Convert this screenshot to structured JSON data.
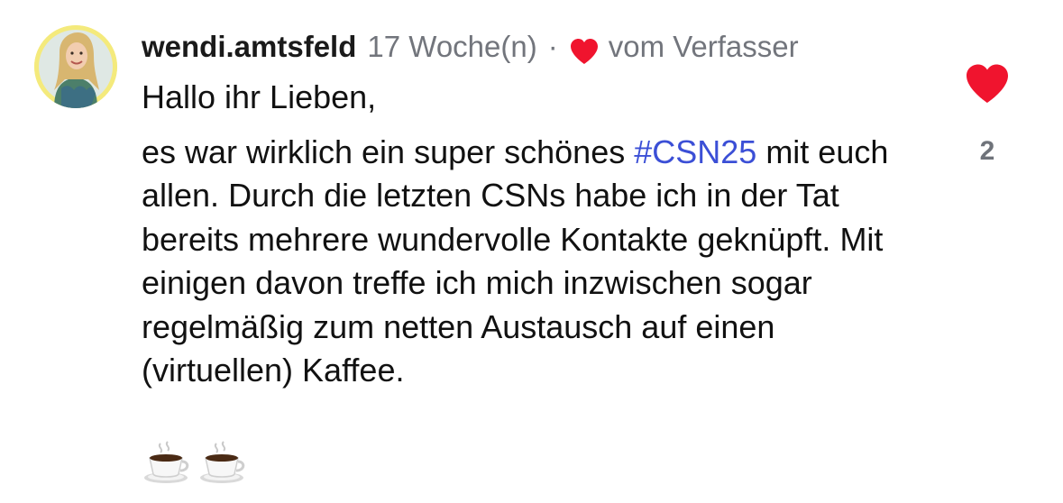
{
  "comment": {
    "username": "wendi.amtsfeld",
    "time": "17 Woche(n)",
    "separator": "·",
    "author_label": "vom Verfasser",
    "greeting": "Hallo ihr Lieben,",
    "text_before_hashtag": "es war wirklich ein super schönes ",
    "hashtag": "#CSN25",
    "text_after_hashtag": " mit euch allen. Durch die letzten CSNs habe ich in der Tat bereits mehrere wundervolle Kontakte geknüpft. Mit einigen davon treffe ich mich inzwischen sogar regelmäßig zum netten Austausch auf einen (virtuellen) Kaffee.",
    "emojis": [
      "coffee-cup",
      "coffee-cup"
    ]
  },
  "like": {
    "icon": "heart-icon",
    "count": "2",
    "color": "#f0142e"
  },
  "colors": {
    "hashtag": "#3b4fd6",
    "meta_text": "#72757c",
    "heart": "#f0142e",
    "avatar_ring": "#f4ea7c"
  }
}
